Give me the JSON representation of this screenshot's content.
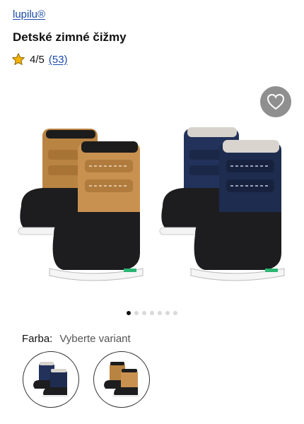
{
  "brand": {
    "name": "lupilu®"
  },
  "product": {
    "title": "Detské zimné čižmy"
  },
  "rating": {
    "score": "4/5",
    "count": "(53)",
    "star_color": "#f5b301"
  },
  "gallery": {
    "slides": 7,
    "active_slide": 1,
    "favorite_icon": "heart-icon"
  },
  "color": {
    "label": "Farba:",
    "value": "Vyberte variant"
  },
  "variants": [
    {
      "name": "navy",
      "color": "#1e2c4f"
    },
    {
      "name": "camel",
      "color": "#c08a45"
    }
  ],
  "colors": {
    "link": "#1a49a8",
    "navy": "#1e2c4f",
    "camel": "#c08a45",
    "sole": "#1d1d1f"
  }
}
